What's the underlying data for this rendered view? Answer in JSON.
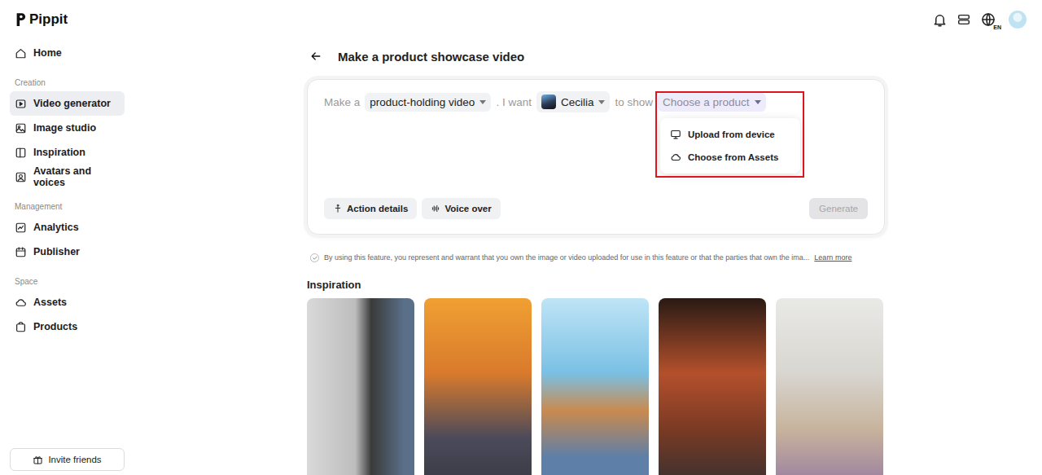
{
  "app": {
    "name": "Pippit"
  },
  "sidebar": {
    "sections": [
      {
        "items": [
          {
            "label": "Home",
            "selected": false
          }
        ]
      },
      {
        "title": "Creation",
        "items": [
          {
            "label": "Video generator",
            "selected": true
          },
          {
            "label": "Image studio",
            "selected": false
          },
          {
            "label": "Inspiration",
            "selected": false
          },
          {
            "label": "Avatars and voices",
            "selected": false
          }
        ]
      },
      {
        "title": "Management",
        "items": [
          {
            "label": "Analytics",
            "selected": false
          },
          {
            "label": "Publisher",
            "selected": false
          }
        ]
      },
      {
        "title": "Space",
        "items": [
          {
            "label": "Assets",
            "selected": false
          },
          {
            "label": "Products",
            "selected": false
          }
        ]
      }
    ],
    "invite": {
      "label": "Invite friends"
    }
  },
  "topbar": {
    "language": "EN"
  },
  "page": {
    "title": "Make a product showcase video"
  },
  "prompt": {
    "parts": [
      {
        "kind": "text",
        "text": "Make a"
      },
      {
        "kind": "chip",
        "text": "product-holding video",
        "expanded": false
      },
      {
        "kind": "text",
        "text": ". I want"
      },
      {
        "kind": "avatar",
        "text": "Cecilia",
        "expanded": false
      },
      {
        "kind": "text",
        "text": "to show"
      },
      {
        "kind": "placeholder",
        "text": "Choose a product",
        "expanded": true
      }
    ],
    "menu": [
      {
        "label": "Upload from device"
      },
      {
        "label": "Choose from Assets"
      }
    ],
    "buttons": [
      {
        "label": "Action details"
      },
      {
        "label": "Voice over"
      }
    ],
    "generate": {
      "label": "Generate",
      "disabled": true
    }
  },
  "disclaimer": {
    "checked": true,
    "text": "By using this feature, you represent and warrant that you own the image or video uploaded for use in this feature or that the parties that own the ima...",
    "link": "Learn more"
  },
  "inspiration": {
    "title": "Inspiration",
    "items": [
      {},
      {},
      {},
      {},
      {}
    ]
  }
}
